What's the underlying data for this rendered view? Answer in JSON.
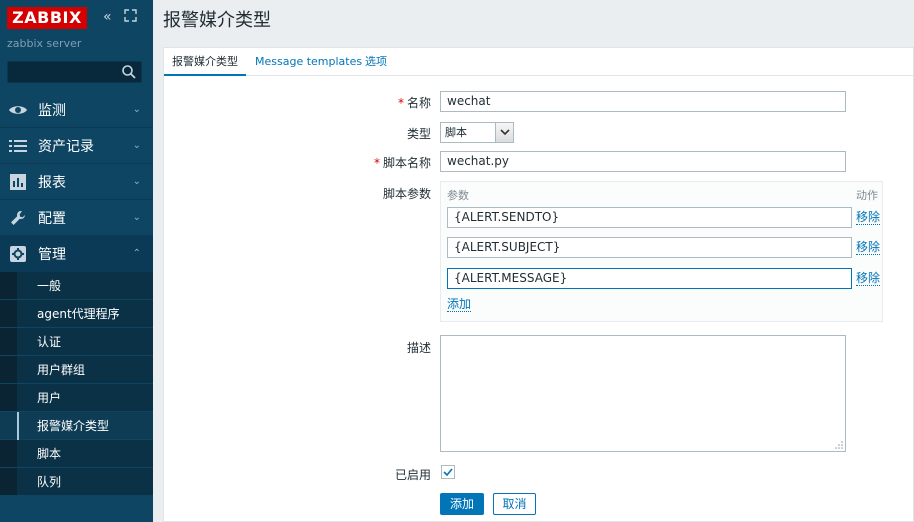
{
  "app": {
    "logo": "ZABBIX",
    "server": "zabbix server"
  },
  "sidebar": {
    "items": [
      {
        "label": "监测",
        "icon": "eye-icon"
      },
      {
        "label": "资产记录",
        "icon": "list-icon"
      },
      {
        "label": "报表",
        "icon": "bar-chart-icon"
      },
      {
        "label": "配置",
        "icon": "wrench-icon"
      },
      {
        "label": "管理",
        "icon": "gear-icon"
      }
    ],
    "submenu": [
      "一般",
      "agent代理程序",
      "认证",
      "用户群组",
      "用户",
      "报警媒介类型",
      "脚本",
      "队列"
    ]
  },
  "page": {
    "title": "报警媒介类型"
  },
  "tabs": [
    "报警媒介类型",
    "Message templates",
    "选项"
  ],
  "form": {
    "name_label": "名称",
    "name_value": "wechat",
    "type_label": "类型",
    "type_value": "脚本",
    "script_name_label": "脚本名称",
    "script_name_value": "wechat.py",
    "script_params_label": "脚本参数",
    "params_header": "参数",
    "actions_header": "动作",
    "params": [
      "{ALERT.SENDTO}",
      "{ALERT.SUBJECT}",
      "{ALERT.MESSAGE}"
    ],
    "remove_label": "移除",
    "add_link": "添加",
    "description_label": "描述",
    "enabled_label": "已启用",
    "enabled": true,
    "submit_button": "添加",
    "cancel_button": "取消"
  },
  "colors": {
    "sidebar": "#0e4563",
    "accent": "#0275b8",
    "logo": "#d40000"
  }
}
